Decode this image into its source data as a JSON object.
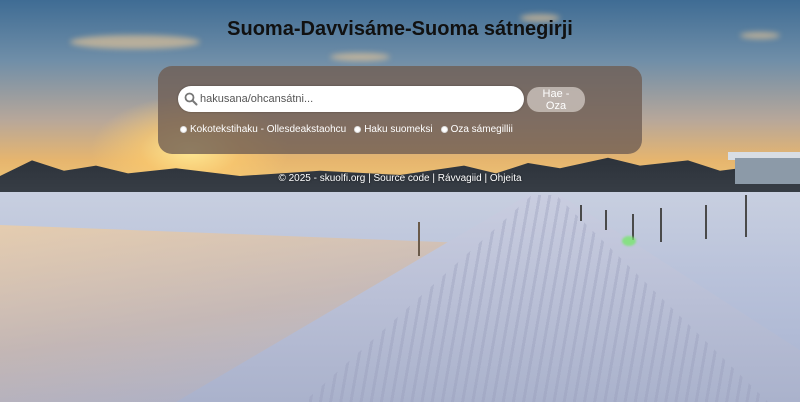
{
  "page": {
    "title": "Suoma-Davvisáme-Suoma sátnegirji"
  },
  "search": {
    "placeholder": "hakusana/ohcansátni...",
    "value": "",
    "button_label": "Hae - Oza",
    "icon": "search-icon"
  },
  "options": [
    {
      "label": "Kokotekstihaku - Ollesdeakstaohcu"
    },
    {
      "label": "Haku suomeksi"
    },
    {
      "label": "Oza sámegillii"
    }
  ],
  "footer": {
    "copyright": "© 2025 - skuolfi.org",
    "sep1": " | ",
    "source_code": "Source code",
    "sep2": " | ",
    "feedback": "Rávvagiid",
    "sep3": " | ",
    "help": "Ohjeita"
  },
  "colors": {
    "panel_bg": "#6e5c52",
    "title_text": "#111111",
    "option_text": "#ffffff"
  }
}
